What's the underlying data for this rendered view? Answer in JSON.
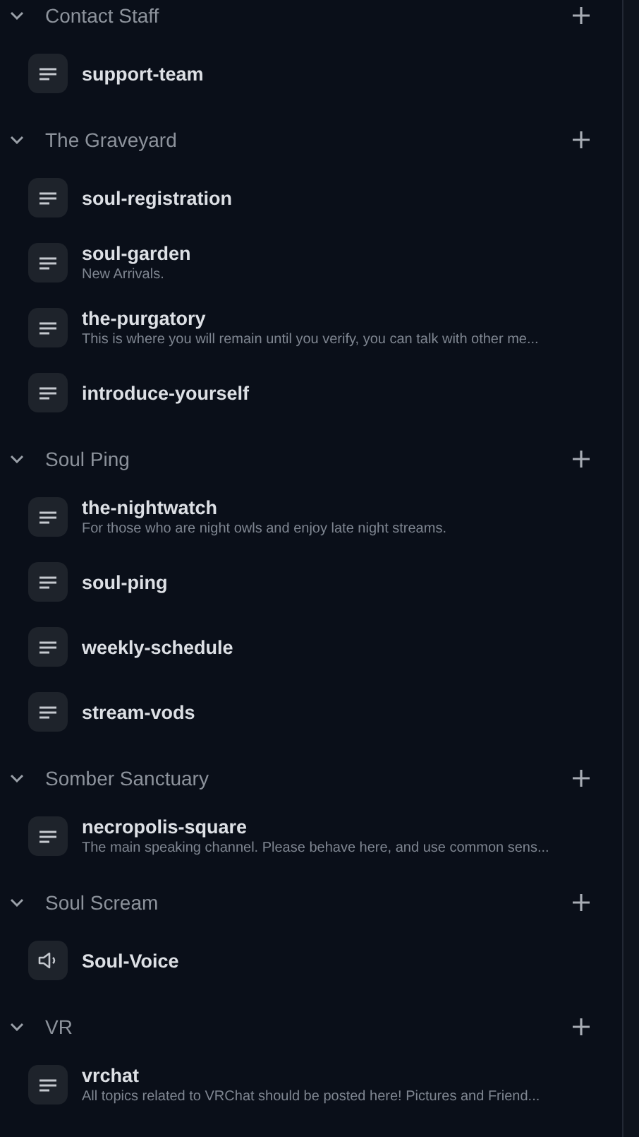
{
  "categories": [
    {
      "name": "Contact Staff",
      "expanded": true,
      "channels": [
        {
          "kind": "text",
          "name": "support-team"
        }
      ]
    },
    {
      "name": "The Graveyard",
      "expanded": true,
      "channels": [
        {
          "kind": "text",
          "name": "soul-registration"
        },
        {
          "kind": "text",
          "name": "soul-garden",
          "topic": "New Arrivals."
        },
        {
          "kind": "text",
          "name": "the-purgatory",
          "topic": "This is where you will remain until you verify, you can talk with other me..."
        },
        {
          "kind": "text",
          "name": "introduce-yourself"
        }
      ]
    },
    {
      "name": "Soul Ping",
      "expanded": true,
      "channels": [
        {
          "kind": "text",
          "name": "the-nightwatch",
          "topic": "For those who are night owls and enjoy late night streams."
        },
        {
          "kind": "text",
          "name": "soul-ping"
        },
        {
          "kind": "text",
          "name": "weekly-schedule"
        },
        {
          "kind": "text",
          "name": "stream-vods"
        }
      ]
    },
    {
      "name": "Somber Sanctuary",
      "expanded": true,
      "channels": [
        {
          "kind": "text",
          "name": "necropolis-square",
          "topic": "The main speaking channel. Please behave here, and use common sens..."
        }
      ]
    },
    {
      "name": "Soul Scream",
      "expanded": true,
      "channels": [
        {
          "kind": "voice",
          "name": "Soul-Voice"
        }
      ]
    },
    {
      "name": "VR",
      "expanded": true,
      "channels": [
        {
          "kind": "text",
          "name": "vrchat",
          "topic": "All topics related to VRChat should be posted here! Pictures and Friend..."
        }
      ]
    }
  ]
}
